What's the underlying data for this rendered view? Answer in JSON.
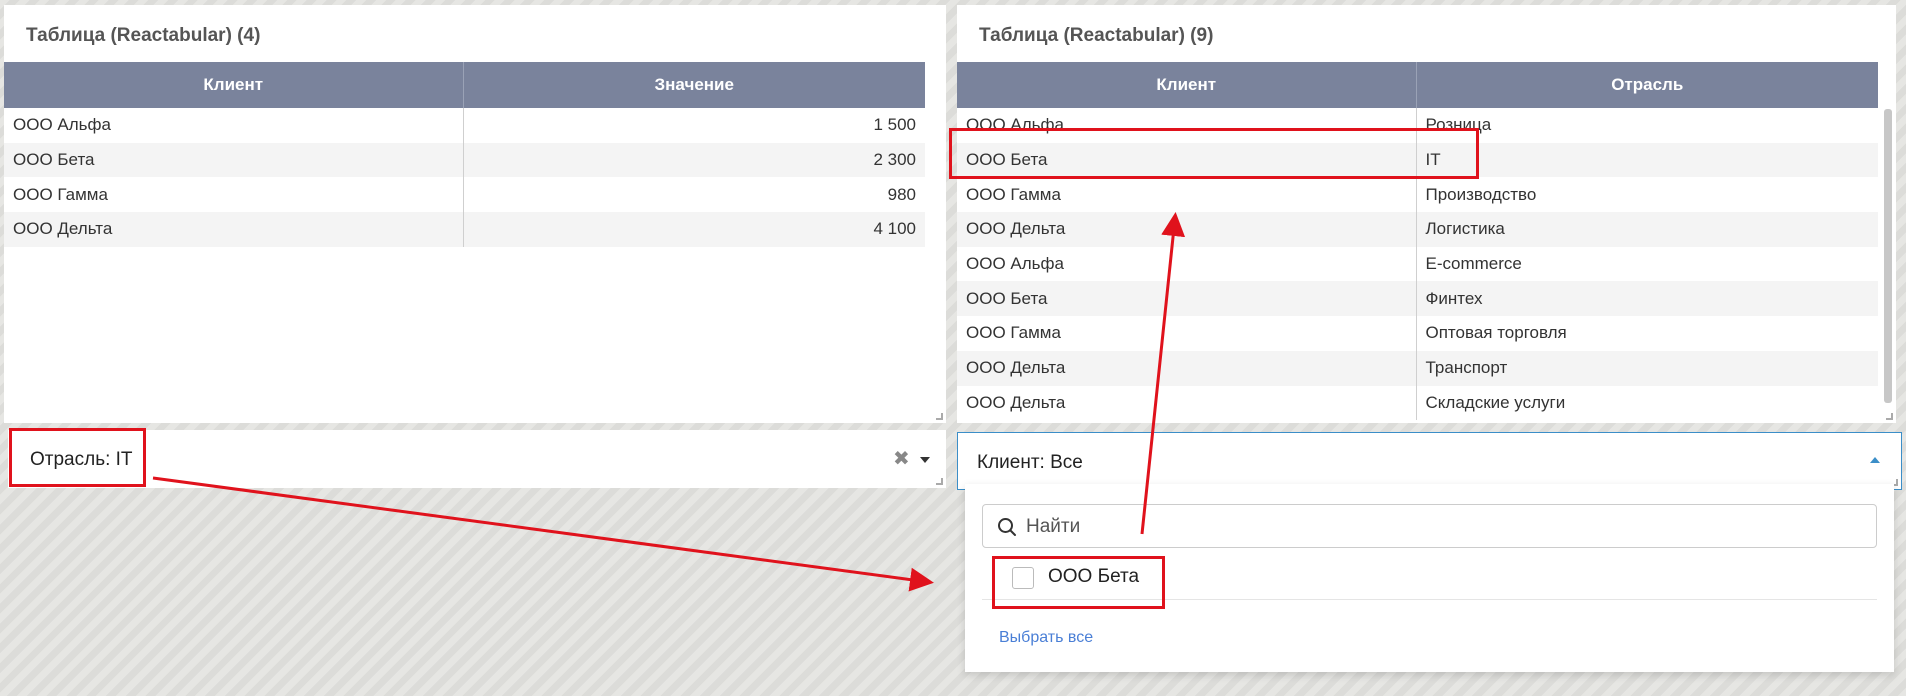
{
  "left_table": {
    "title": "Таблица (Reactabular) (4)",
    "columns": [
      "Клиент",
      "Значение"
    ],
    "rows": [
      [
        "ООО Альфа",
        "1 500"
      ],
      [
        "ООО Бета",
        "2 300"
      ],
      [
        "ООО Гамма",
        "980"
      ],
      [
        "ООО Дельта",
        "4 100"
      ]
    ]
  },
  "right_table": {
    "title": "Таблица (Reactabular) (9)",
    "columns": [
      "Клиент",
      "Отрасль"
    ],
    "rows": [
      [
        "ООО Альфа",
        "Розница"
      ],
      [
        "ООО Бета",
        "IT"
      ],
      [
        "ООО Гамма",
        "Производство"
      ],
      [
        "ООО Дельта",
        "Логистика"
      ],
      [
        "ООО Альфа",
        "E-commerce"
      ],
      [
        "ООО Бета",
        "Финтех"
      ],
      [
        "ООО Гамма",
        "Оптовая торговля"
      ],
      [
        "ООО Дельта",
        "Транспорт"
      ],
      [
        "ООО Дельта",
        "Складские услуги"
      ]
    ]
  },
  "industry_filter": {
    "label": "Отрасль: IT",
    "clear_icon": "close-icon"
  },
  "client_filter": {
    "label": "Клиент: Все",
    "search_placeholder": "Найти",
    "options": [
      "ООО Бета"
    ],
    "select_all": "Выбрать все"
  },
  "colors": {
    "header_bg": "#7a839c",
    "highlight": "#e0121c",
    "link": "#4a7fd6"
  }
}
